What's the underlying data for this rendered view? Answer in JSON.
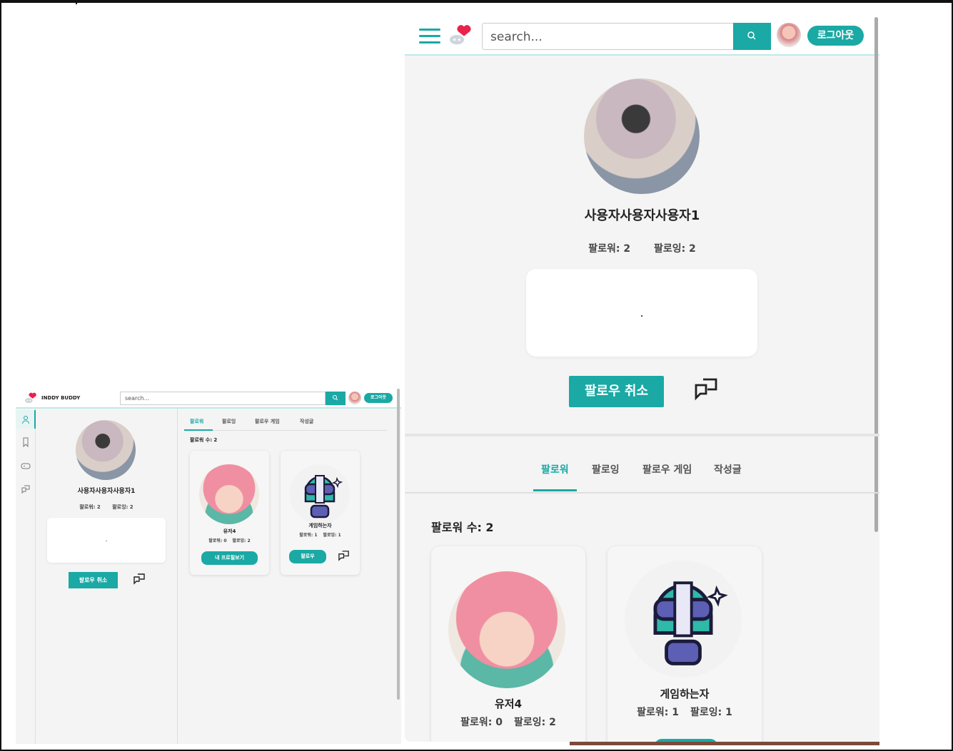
{
  "app": {
    "brand": "INDDY BUDDY",
    "accent": "#1aa9a4"
  },
  "header": {
    "search_placeholder": "search...",
    "logout_label": "로그아웃"
  },
  "sidebar": {
    "items": [
      {
        "icon": "person-icon"
      },
      {
        "icon": "bookmark-icon"
      },
      {
        "icon": "gamepad-icon"
      },
      {
        "icon": "chat-icon"
      }
    ]
  },
  "profile": {
    "name": "사용자사용자사용자1",
    "followers_label": "팔로워: 2",
    "following_label": "팔로잉: 2",
    "bio": ".",
    "unfollow_label": "팔로우 취소"
  },
  "tabs": [
    {
      "label": "팔로워",
      "active": true
    },
    {
      "label": "팔로잉",
      "active": false
    },
    {
      "label": "팔로우 게임",
      "active": false
    },
    {
      "label": "작성글",
      "active": false
    }
  ],
  "follower_count_label": "팔로워 수: 2",
  "cards": [
    {
      "name": "유저4",
      "followers_label": "팔로워: 0",
      "following_label": "팔로잉: 2",
      "button_label": "내 프로필보기"
    },
    {
      "name": "게임하는자",
      "followers_label": "팔로워: 1",
      "following_label": "팔로잉: 1",
      "button_label": "팔로우"
    }
  ]
}
